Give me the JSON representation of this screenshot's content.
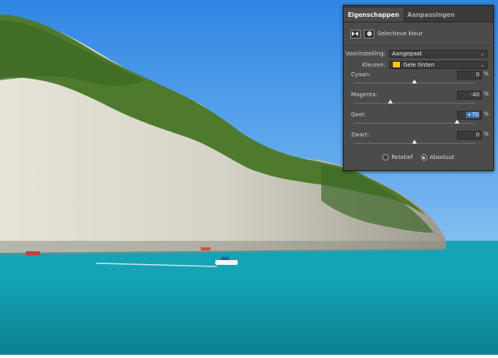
{
  "panel": {
    "tabs": [
      {
        "label": "Eigenschappen",
        "active": true
      },
      {
        "label": "Aanpassingen",
        "active": false
      }
    ],
    "adjustment_name": "Selectieve kleur",
    "preset": {
      "label": "Voorinstelling:",
      "value": "Aangepast"
    },
    "colors": {
      "label": "Kleuren:",
      "value": "Gele tinten",
      "swatch": "#f4c81f"
    },
    "sliders": [
      {
        "label": "Cyaan:",
        "value": "0",
        "unit": "%",
        "level": 0
      },
      {
        "label": "Magenta:",
        "value": "-40",
        "unit": "%",
        "level": -40
      },
      {
        "label": "Geel:",
        "value": "+70",
        "unit": "%",
        "level": 70,
        "highlighted": true
      },
      {
        "label": "Zwart:",
        "value": "0",
        "unit": "%",
        "level": 0
      }
    ],
    "method": {
      "options": [
        {
          "label": "Relatief",
          "selected": false
        },
        {
          "label": "Absoluut",
          "selected": true
        }
      ]
    }
  }
}
